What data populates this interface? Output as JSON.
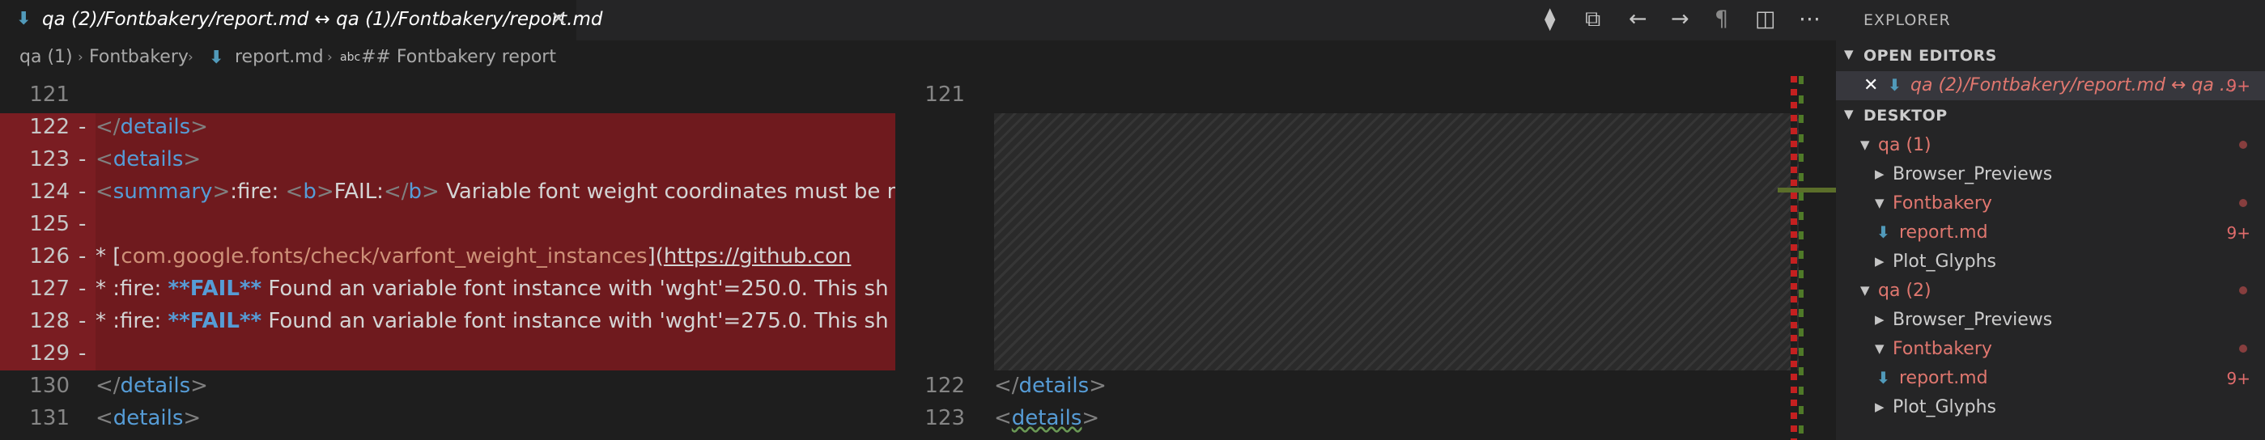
{
  "tab": {
    "title": "qa (2)/Fontbakery/report.md ↔ qa (1)/Fontbakery/report.md",
    "close": "✕",
    "file_icon": "⬇"
  },
  "editor_actions": {
    "open_changes": "⧫",
    "split_inline": "⧉",
    "prev_change": "←",
    "next_change": "→",
    "toggle_whitespace": "¶",
    "split_editor": "◫",
    "more": "⋯"
  },
  "breadcrumb": {
    "folder": "qa (1)",
    "subfolder": "Fontbakery",
    "file": "report.md",
    "symbol_icon": "abc",
    "symbol": "## Fontbakery report"
  },
  "left_lines": [
    {
      "num": "121",
      "kind": "normal",
      "mark": ""
    },
    {
      "num": "122",
      "kind": "del",
      "mark": "-"
    },
    {
      "num": "123",
      "kind": "del",
      "mark": "-"
    },
    {
      "num": "124",
      "kind": "del",
      "mark": "-"
    },
    {
      "num": "125",
      "kind": "del",
      "mark": "-"
    },
    {
      "num": "126",
      "kind": "del",
      "mark": "-"
    },
    {
      "num": "127",
      "kind": "del",
      "mark": "-"
    },
    {
      "num": "128",
      "kind": "del",
      "mark": "-"
    },
    {
      "num": "129",
      "kind": "del",
      "mark": "-"
    },
    {
      "num": "130",
      "kind": "normal",
      "mark": ""
    },
    {
      "num": "131",
      "kind": "normal",
      "mark": ""
    }
  ],
  "code": {
    "l122": "details",
    "l123": "details",
    "l124_tag": "summary",
    "l124_a": ":fire: ",
    "l124_b": "b",
    "l124_fail": "FAIL:",
    "l124_rest": " Variable font weight coordinates must be m",
    "l126_star": "* [",
    "l126_link": "com.google.fonts/check/varfont_weight_instances",
    "l126_mid": "](",
    "l126_url": "https://github.con",
    "l127_a": "* :fire: ",
    "l127_bold": "**FAIL**",
    "l127_rest": " Found an variable font instance with 'wght'=250.0. This sh",
    "l128_a": "* :fire: ",
    "l128_bold": "**FAIL**",
    "l128_rest": " Found an variable font instance with 'wght'=275.0. This sh",
    "l130": "details",
    "l131": "details"
  },
  "right_lines": [
    {
      "num": "121"
    },
    {
      "num": "122"
    },
    {
      "num": "123"
    }
  ],
  "right_code": {
    "l122": "details",
    "l123": "details"
  },
  "explorer": {
    "title": "EXPLORER",
    "open_editors": "OPEN EDITORS",
    "open_editor_item": "qa (2)/Fontbakery/report.md ↔ qa ...",
    "open_editor_count": "9+",
    "desktop": "DESKTOP",
    "tree": [
      {
        "label": "qa (1)",
        "depth": 1,
        "twisty": "▼",
        "style": "mod",
        "badge": "dot"
      },
      {
        "label": "Browser_Previews",
        "depth": 2,
        "twisty": "▶",
        "style": "plain",
        "badge": ""
      },
      {
        "label": "Fontbakery",
        "depth": 2,
        "twisty": "▼",
        "style": "mod",
        "badge": "dot"
      },
      {
        "label": "report.md",
        "depth": 3,
        "twisty": "",
        "style": "mod",
        "badge": "9+"
      },
      {
        "label": "Plot_Glyphs",
        "depth": 2,
        "twisty": "▶",
        "style": "plain",
        "badge": ""
      },
      {
        "label": "qa (2)",
        "depth": 1,
        "twisty": "▼",
        "style": "mod",
        "badge": "dot"
      },
      {
        "label": "Browser_Previews",
        "depth": 2,
        "twisty": "▶",
        "style": "plain",
        "badge": ""
      },
      {
        "label": "Fontbakery",
        "depth": 2,
        "twisty": "▼",
        "style": "mod",
        "badge": "dot"
      },
      {
        "label": "report.md",
        "depth": 3,
        "twisty": "",
        "style": "mod",
        "badge": "9+"
      },
      {
        "label": "Plot_Glyphs",
        "depth": 2,
        "twisty": "▶",
        "style": "plain",
        "badge": ""
      }
    ]
  },
  "colors": {
    "deleted_line_bg": "#6f1a1e",
    "deleted_gutter_bg": "#7a1d22",
    "modified": "#e0776f",
    "tag": "#569cd6"
  }
}
